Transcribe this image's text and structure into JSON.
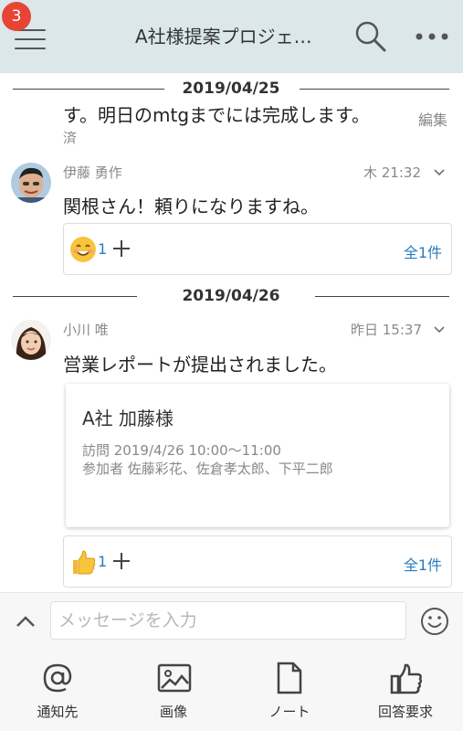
{
  "header": {
    "badge_count": "3",
    "title": "A社様提案プロジェ…"
  },
  "messages": {
    "sep1_date": "2019/04/25",
    "prev_text": "す。明日のmtgまでには完成します。",
    "prev_edit": "編集",
    "prev_status": "済",
    "msg1": {
      "sender": "伊藤 勇作",
      "time": "木 21:32",
      "text": "関根さん！頼りになりますね。",
      "reaction_count": "1",
      "total": "全1件"
    },
    "sep2_date": "2019/04/26",
    "msg2": {
      "sender": "小川 唯",
      "time": "昨日 15:37",
      "text": "営業レポートが提出されました。",
      "card_title": "A社 加藤様",
      "card_visit": "訪問 2019/4/26 10:00〜11:00",
      "card_attendees": "参加者 佐藤彩花、佐倉孝太郎、下平二郎",
      "reaction_count": "1",
      "total": "全1件"
    }
  },
  "input": {
    "placeholder": "メッセージを入力"
  },
  "toolbar": {
    "mention_label": "通知先",
    "image_label": "画像",
    "note_label": "ノート",
    "request_label": "回答要求"
  },
  "colors": {
    "header_bg": "#dbe7ea",
    "badge": "#e84434",
    "link": "#2a7cbf"
  }
}
